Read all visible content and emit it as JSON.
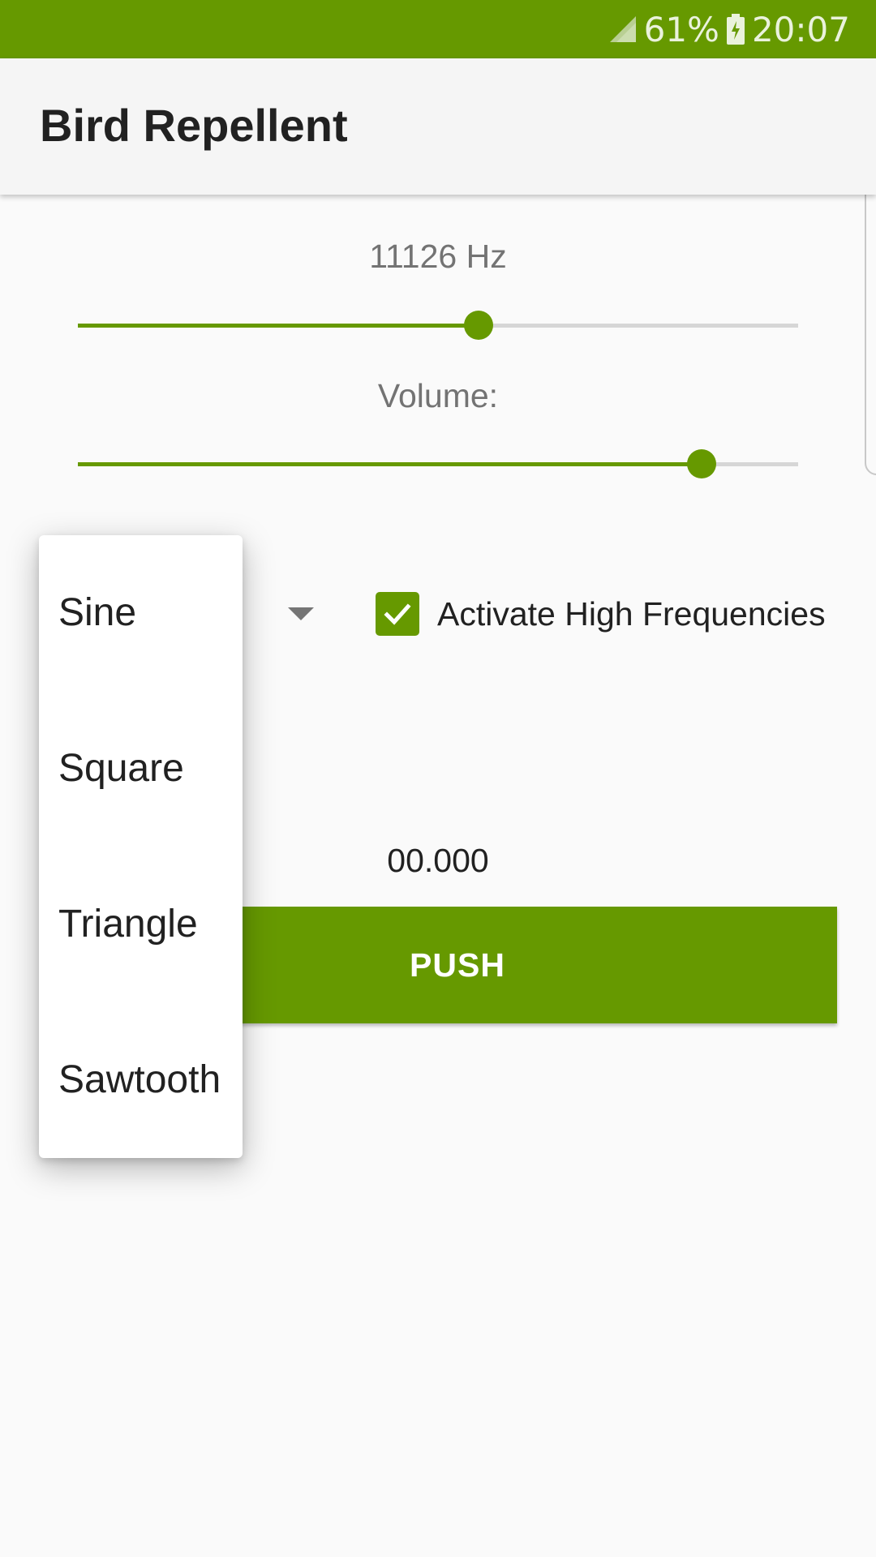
{
  "status_bar": {
    "battery": "61%",
    "time": "20:07",
    "icons": [
      "signal-icon",
      "battery-charging-icon"
    ],
    "color": "#669900"
  },
  "app_bar": {
    "title": "Bird Repellent"
  },
  "frequency": {
    "label": "11126 Hz",
    "slider_value_fraction": 0.556
  },
  "volume": {
    "label": "Volume:",
    "slider_value_fraction": 0.866
  },
  "waveform_dropdown": {
    "options": [
      "Sine",
      "Square",
      "Triangle",
      "Sawtooth"
    ],
    "arrow_icon": "dropdown-arrow-icon"
  },
  "high_freq_checkbox": {
    "label": "Activate High Frequencies",
    "checked": true,
    "icon": "check-icon"
  },
  "timer": {
    "value": "00.000"
  },
  "push_button": {
    "label": "PUSH"
  },
  "colors": {
    "accent": "#669900",
    "app_bar_bg": "#f5f5f5",
    "background": "#fafafa"
  }
}
